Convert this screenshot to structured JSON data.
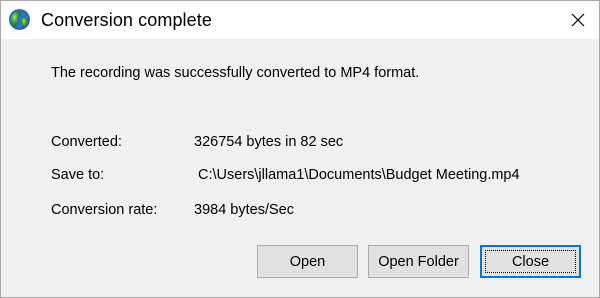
{
  "window": {
    "title": "Conversion complete",
    "app_icon": "globe-icon",
    "close_icon": "close-icon"
  },
  "message": "The recording was successfully converted to MP4 format.",
  "details": {
    "converted_label": "Converted:",
    "converted_value": "326754 bytes in 82 sec",
    "save_to_label": "Save to:",
    "save_to_value": "C:\\Users\\jllama1\\Documents\\Budget Meeting.mp4",
    "rate_label": "Conversion rate:",
    "rate_value": "3984 bytes/Sec"
  },
  "buttons": {
    "open": "Open",
    "open_folder": "Open Folder",
    "close": "Close"
  },
  "colors": {
    "dialog_background": "#f0f0f0",
    "titlebar_background": "#ffffff",
    "button_background": "#e1e1e1",
    "default_button_border": "#0078d7"
  }
}
